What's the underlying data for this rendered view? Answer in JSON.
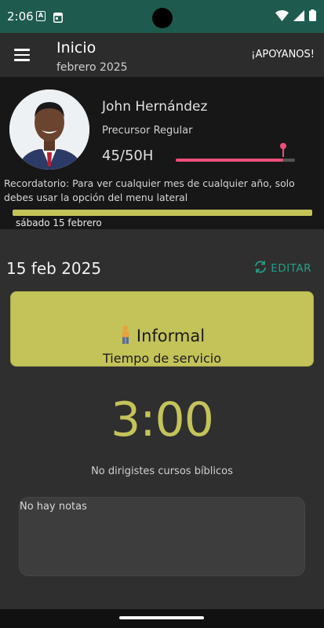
{
  "status_bar": {
    "time": "2:06",
    "icon_a": "A",
    "icon_calendar": "calendar-icon"
  },
  "app_bar": {
    "title": "Inicio",
    "subtitle": "febrero 2025",
    "support_label": "¡APOYANOS!"
  },
  "profile": {
    "name": "John Hernández",
    "role": "Precursor Regular",
    "hours_text": "45/50H",
    "hours_progress": 0.9,
    "accent_color": "#ec4f7a"
  },
  "reminder": "Recordatorio: Para ver cualquier mes de cualquier año, solo debes usar la opción del menu lateral",
  "day_label": "sábado 15 febrero",
  "detail": {
    "date": "15 feb 2025",
    "edit_label": "EDITAR",
    "service_type": "Informal",
    "service_desc": "Tiempo de servicio",
    "time": "3:00",
    "courses_text": "No dirigistes cursos bíblicos",
    "notes": "No hay notas"
  },
  "colors": {
    "status_bar": "#1e5a4d",
    "card": "#c4c35a",
    "edit": "#25a08a",
    "background": "#2f2f2f"
  }
}
